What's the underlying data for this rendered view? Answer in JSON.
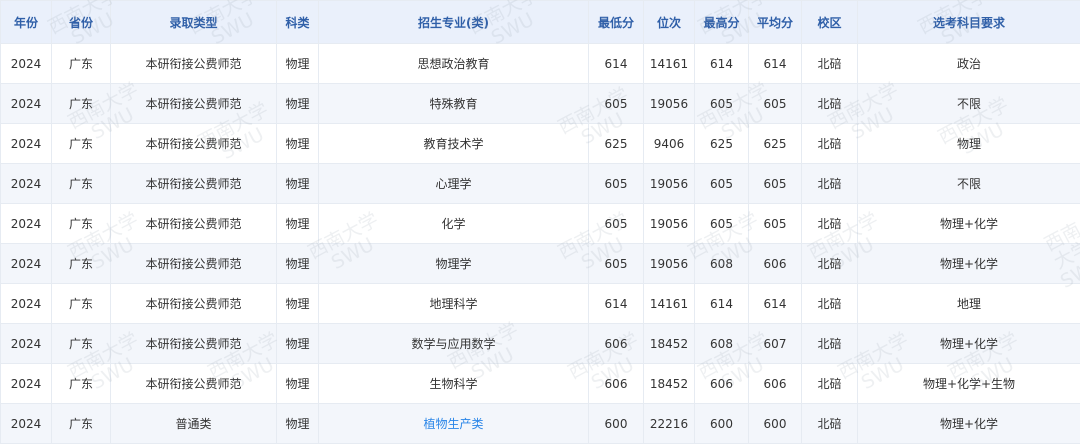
{
  "table": {
    "columns": [
      "年份",
      "省份",
      "录取类型",
      "科类",
      "招生专业(类)",
      "最低分",
      "位次",
      "最高分",
      "平均分",
      "校区",
      "选考科目要求"
    ],
    "rows": [
      [
        "2024",
        "广东",
        "本研衔接公费师范",
        "物理",
        "思想政治教育",
        "614",
        "14161",
        "614",
        "614",
        "北碚",
        "政治"
      ],
      [
        "2024",
        "广东",
        "本研衔接公费师范",
        "物理",
        "特殊教育",
        "605",
        "19056",
        "605",
        "605",
        "北碚",
        "不限"
      ],
      [
        "2024",
        "广东",
        "本研衔接公费师范",
        "物理",
        "教育技术学",
        "625",
        "9406",
        "625",
        "625",
        "北碚",
        "物理"
      ],
      [
        "2024",
        "广东",
        "本研衔接公费师范",
        "物理",
        "心理学",
        "605",
        "19056",
        "605",
        "605",
        "北碚",
        "不限"
      ],
      [
        "2024",
        "广东",
        "本研衔接公费师范",
        "物理",
        "化学",
        "605",
        "19056",
        "605",
        "605",
        "北碚",
        "物理+化学"
      ],
      [
        "2024",
        "广东",
        "本研衔接公费师范",
        "物理",
        "物理学",
        "605",
        "19056",
        "608",
        "606",
        "北碚",
        "物理+化学"
      ],
      [
        "2024",
        "广东",
        "本研衔接公费师范",
        "物理",
        "地理科学",
        "614",
        "14161",
        "614",
        "614",
        "北碚",
        "地理"
      ],
      [
        "2024",
        "广东",
        "本研衔接公费师范",
        "物理",
        "数学与应用数学",
        "606",
        "18452",
        "608",
        "607",
        "北碚",
        "物理+化学"
      ],
      [
        "2024",
        "广东",
        "本研衔接公费师范",
        "物理",
        "生物科学",
        "606",
        "18452",
        "606",
        "606",
        "北碚",
        "物理+化学+生物"
      ],
      [
        "2024",
        "广东",
        "普通类",
        "物理",
        "植物生产类",
        "600",
        "22216",
        "600",
        "600",
        "北碚",
        "物理+化学"
      ]
    ]
  },
  "watermark": {
    "line1": "西南大学",
    "line2": "SWU"
  },
  "colors": {
    "header_bg": "#eaf0fb",
    "header_text": "#2f5fa8",
    "link_text": "#2a86e8",
    "zebra_bg": "#f3f6fb"
  }
}
